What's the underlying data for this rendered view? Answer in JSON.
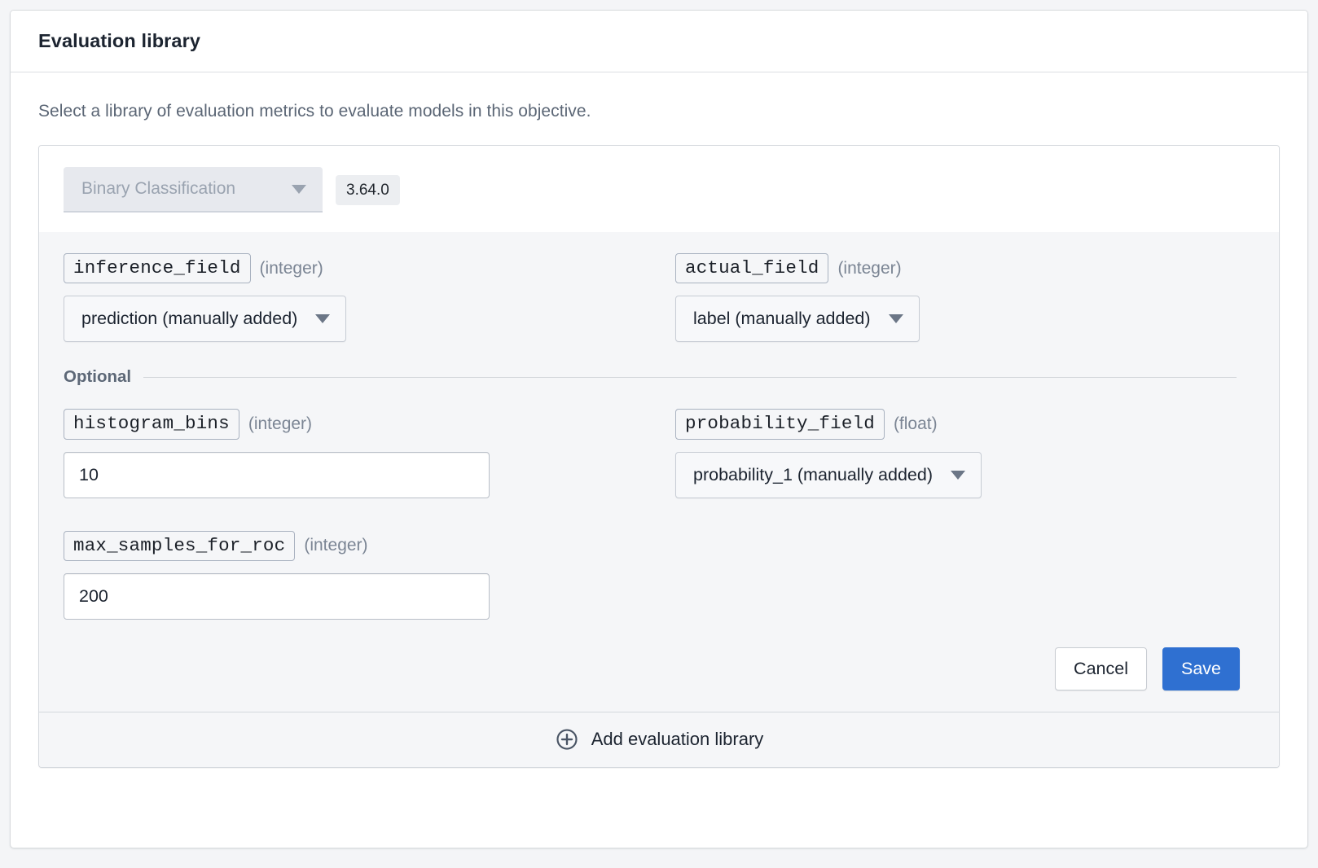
{
  "panel": {
    "title": "Evaluation library",
    "intro": "Select a library of evaluation metrics to evaluate models in this objective."
  },
  "library": {
    "type_select": {
      "value": "Binary Classification",
      "caret_icon": "chevron-down-icon"
    },
    "version": "3.64.0",
    "required_params": [
      {
        "name": "inference_field",
        "type": "(integer)",
        "control": "select",
        "value": "prediction (manually added)",
        "caret_icon": "chevron-down-icon"
      },
      {
        "name": "actual_field",
        "type": "(integer)",
        "control": "select",
        "value": "label (manually added)",
        "caret_icon": "chevron-down-icon"
      }
    ],
    "optional_label": "Optional",
    "optional_params": [
      {
        "name": "histogram_bins",
        "type": "(integer)",
        "control": "text",
        "value": "10"
      },
      {
        "name": "probability_field",
        "type": "(float)",
        "control": "select",
        "value": "probability_1 (manually added)",
        "caret_icon": "chevron-down-icon"
      },
      {
        "name": "max_samples_for_roc",
        "type": "(integer)",
        "control": "text",
        "value": "200"
      }
    ],
    "actions": {
      "cancel_label": "Cancel",
      "save_label": "Save"
    }
  },
  "footer": {
    "add_label": "Add evaluation library",
    "add_icon": "plus-circle-icon"
  },
  "colors": {
    "accent_blue": "#2f70d1",
    "body_background": "#f5f6f8",
    "muted_text": "#7b8594"
  }
}
